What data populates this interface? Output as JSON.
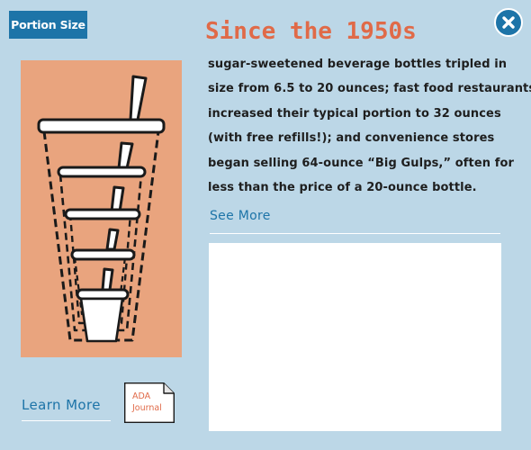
{
  "header": {
    "tag_label": "Portion Size",
    "title": "Since the 1950s"
  },
  "body": {
    "lines": [
      "sugar-sweetened beverage bottles tripled in",
      "size from 6.5 to 20 ounces; fast food restaurants",
      "increased their typical portion to 32 ounces",
      "(with free refills!); and convenience stores",
      "began selling 64-ounce “Big Gulps,” often for",
      "less than the price of a 20-ounce bottle."
    ]
  },
  "links": {
    "see_more": "See More",
    "learn_more": "Learn More"
  },
  "journal": {
    "label": "ADA\nJournal"
  },
  "icons": {
    "close": "close-x-icon",
    "illustration": "nested-cups-illustration",
    "document": "document-icon"
  },
  "colors": {
    "background": "#bcd7e7",
    "accent_blue": "#1d74a8",
    "title_orange": "#e06a48",
    "illustration_bg": "#e9a47e",
    "text": "#1e1e1e"
  }
}
